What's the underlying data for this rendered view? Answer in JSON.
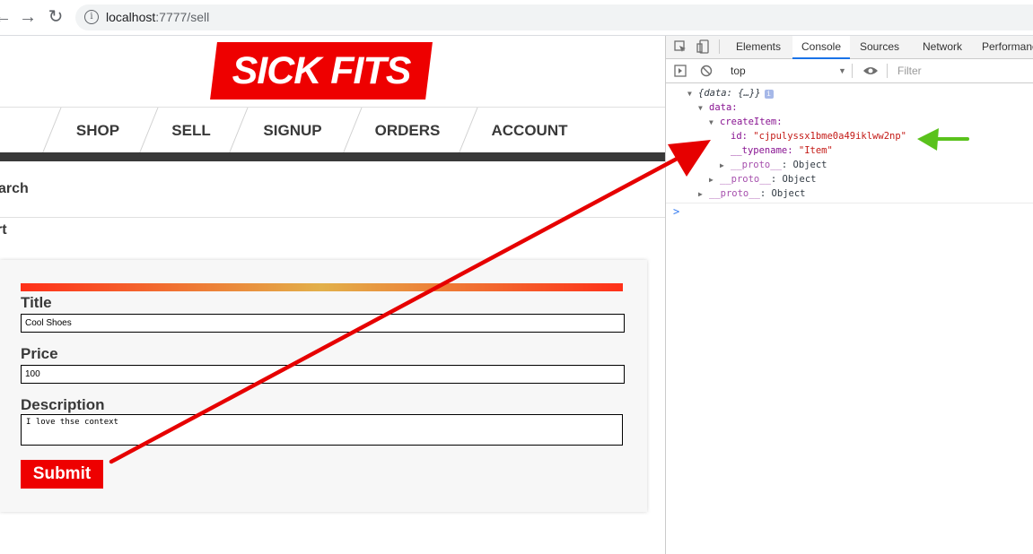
{
  "browser": {
    "back_icon": "←",
    "forward_icon": "→",
    "reload_icon": "↻",
    "info_icon": "i",
    "url_host": "localhost",
    "url_path": ":7777/sell"
  },
  "page": {
    "logo": "SICK FITS",
    "nav": [
      "SHOP",
      "SELL",
      "SIGNUP",
      "ORDERS",
      "ACCOUNT"
    ],
    "search_label": "arch",
    "cart_label": "rt",
    "form": {
      "title_label": "Title",
      "title_value": "Cool Shoes",
      "price_label": "Price",
      "price_value": "100",
      "description_label": "Description",
      "description_value": "I love thse context",
      "submit_label": "Submit"
    }
  },
  "devtools": {
    "tabs": [
      "Elements",
      "Console",
      "Sources",
      "Network",
      "Performanc"
    ],
    "active_tab": "Console",
    "context": "top",
    "filter_placeholder": "Filter",
    "console": {
      "root": "{data: {…}}",
      "data_key": "data:",
      "createItem_key": "createItem:",
      "id_key": "id:",
      "id_value": "\"cjpulyssx1bme0a49iklww2np\"",
      "typename_key": "__typename:",
      "typename_value": "\"Item\"",
      "proto_key": "__proto__",
      "proto_value": ": Object",
      "prompt": ">"
    }
  },
  "colors": {
    "brand_red": "#ee0000",
    "arrow_red": "#e60000",
    "arrow_green": "#5ac21c"
  }
}
